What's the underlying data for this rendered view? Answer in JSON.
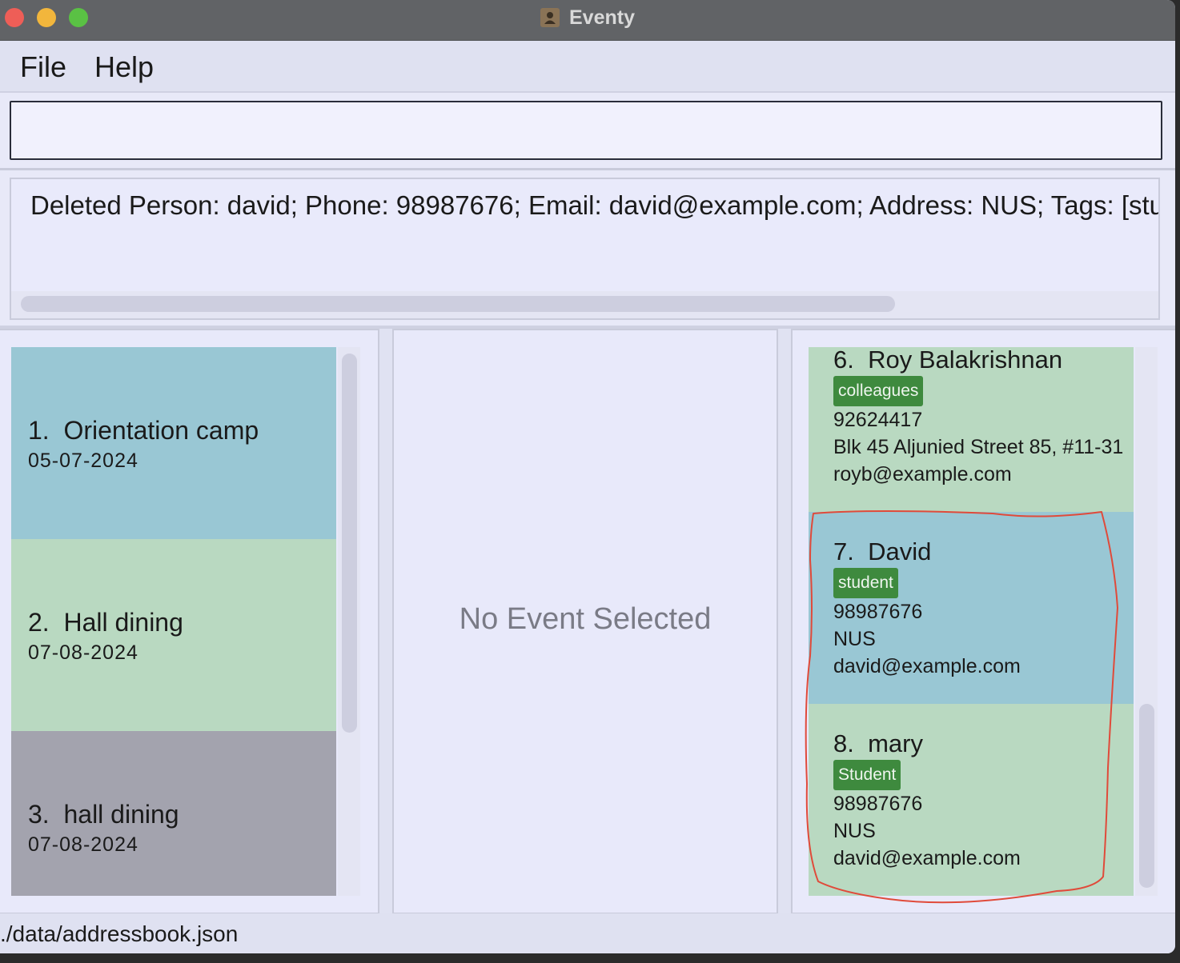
{
  "window": {
    "title": "Eventy",
    "app_icon": "person-app-icon"
  },
  "menu": {
    "file": "File",
    "help": "Help"
  },
  "command": {
    "value": ""
  },
  "result": {
    "text": "Deleted Person: david; Phone: 98987676; Email: david@example.com; Address: NUS; Tags: [student]]"
  },
  "events": [
    {
      "index": "1.",
      "name": "Orientation camp",
      "date": "05-07-2024",
      "color": "#99c7d4"
    },
    {
      "index": "2.",
      "name": "Hall dining",
      "date": "07-08-2024",
      "color": "#b9d9c1"
    },
    {
      "index": "3.",
      "name": "hall dining",
      "date": "07-08-2024",
      "color": "#a3a3ae"
    }
  ],
  "event_detail": {
    "placeholder": "No Event Selected"
  },
  "persons": [
    {
      "index": "6.",
      "name": "Roy Balakrishnan",
      "tag": "colleagues",
      "phone": "92624417",
      "address": "Blk 45 Aljunied Street 85, #11-31",
      "email": "royb@example.com",
      "color": "#b9d9c1"
    },
    {
      "index": "7.",
      "name": "David",
      "tag": "student",
      "phone": "98987676",
      "address": "NUS",
      "email": "david@example.com",
      "color": "#99c7d4"
    },
    {
      "index": "8.",
      "name": "mary",
      "tag": "Student",
      "phone": "98987676",
      "address": "NUS",
      "email": "david@example.com",
      "color": "#b9d9c1"
    }
  ],
  "status": {
    "file_path": "./data/addressbook.json"
  },
  "colors": {
    "tag_green": "#3e8a3e",
    "annotation_red": "#e04a3a"
  }
}
